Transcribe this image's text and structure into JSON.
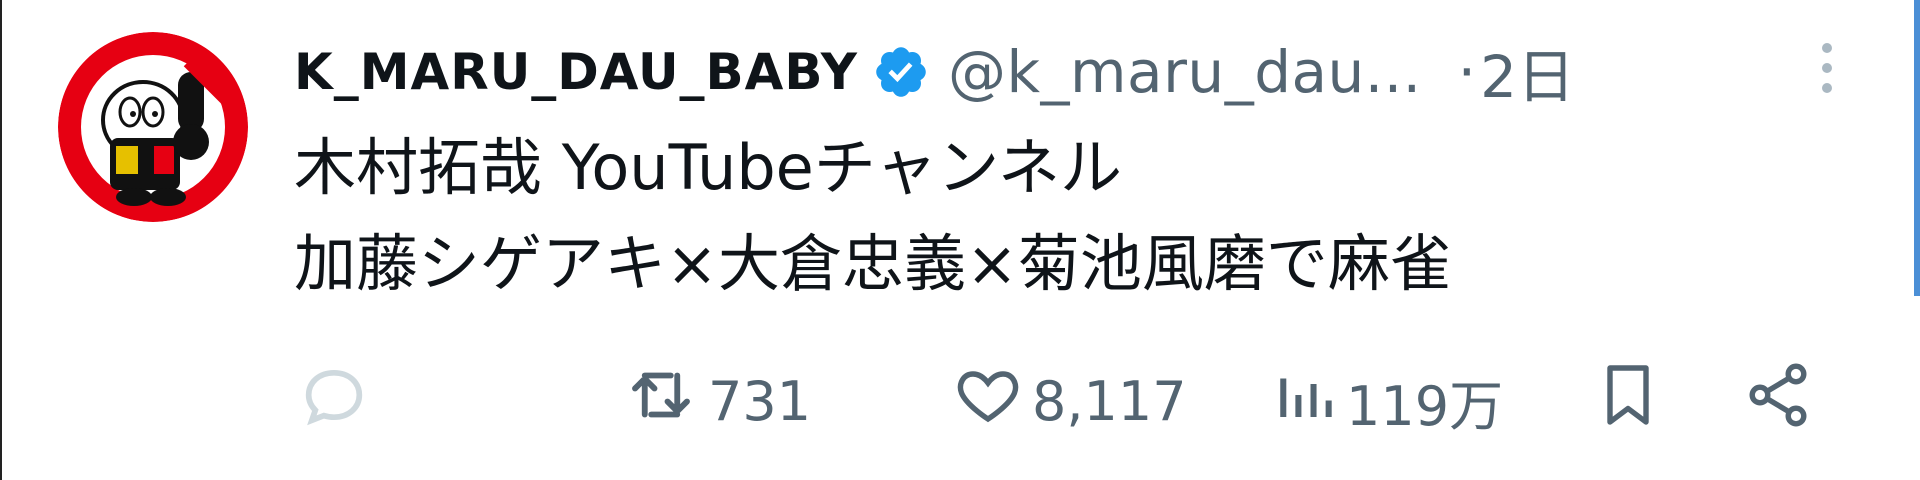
{
  "tweet": {
    "author": {
      "display_name": "K_MARU_DAU_BABY",
      "handle": "@k_maru_dau...",
      "verified": true
    },
    "separator": "·",
    "time": "2日",
    "text_lines": [
      "木村拓哉 YouTubeチャンネル",
      "加藤シゲアキ×大倉忠義×菊池風磨で麻雀"
    ],
    "metrics": {
      "retweets": "731",
      "likes": "8,117",
      "views": "119万"
    }
  },
  "icons": {
    "verified": "verified-badge-icon",
    "more": "more-vertical-icon",
    "reply": "reply-bubble-icon",
    "retweet": "retweet-icon",
    "like": "heart-icon",
    "views": "views-bar-chart-icon",
    "bookmark": "bookmark-icon",
    "share": "share-icon"
  },
  "colors": {
    "text_primary": "#0f1419",
    "text_secondary": "#536471",
    "verified_blue": "#1d9bf0",
    "avatar_red": "#e60012",
    "scrollbar": "#4b8fd6"
  }
}
